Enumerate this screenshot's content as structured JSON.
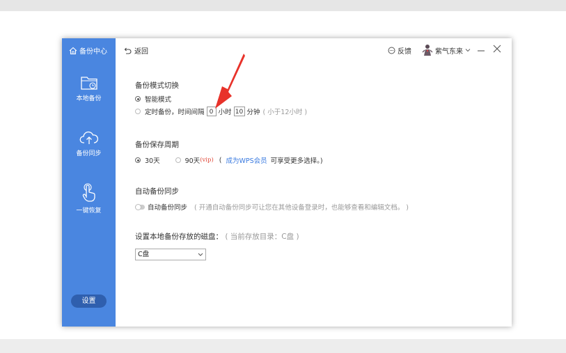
{
  "sidebar": {
    "brand": "备份中心",
    "items": [
      {
        "label": "本地备份",
        "icon": "folder-clock-icon"
      },
      {
        "label": "备份同步",
        "icon": "cloud-upload-icon"
      },
      {
        "label": "一键恢复",
        "icon": "hand-pointer-icon"
      }
    ],
    "settings": "设置"
  },
  "topbar": {
    "back": "返回",
    "feedback": "反馈",
    "username": "紫气东来"
  },
  "mode": {
    "title": "备份模式切换",
    "smart": "智能模式",
    "timed_prefix": "定时备份，时间间隔",
    "hours_value": "0",
    "hours_unit": "小时",
    "minutes_value": "10",
    "minutes_unit": "分钟",
    "hint": "( 小于12小时 )"
  },
  "retention": {
    "title": "备份保存周期",
    "opt30": "30天",
    "opt90": "90天",
    "vip": "(vip)",
    "paren_open": "(",
    "link": "成为WPS会员",
    "more": "可享受更多选择。)"
  },
  "auto_sync": {
    "title": "自动备份同步",
    "toggle_label": "自动备份同步",
    "hint": "( 开通自动备份同步可让您在其他设备登录时，也能够查看和编辑文档。 )"
  },
  "disk": {
    "title": "设置本地备份存放的磁盘：",
    "current": "( 当前存放目录：C盘 )",
    "selected": "C盘"
  },
  "colors": {
    "sidebar": "#4a86e0",
    "settings_button": "#2f5fae",
    "link": "#3b7be0",
    "arrow": "#e8322a"
  }
}
